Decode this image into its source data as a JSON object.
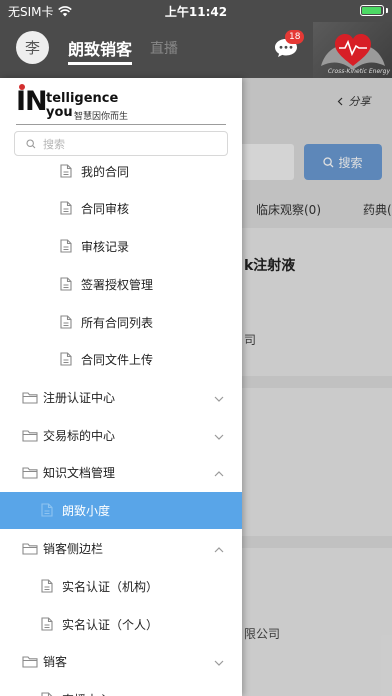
{
  "status_bar": {
    "carrier": "无SIM卡",
    "time": "上午11:42",
    "battery_level": 0.95
  },
  "header": {
    "avatar_char": "李",
    "tab_main": "朗致销客",
    "tab_live": "直播",
    "message_count": "18",
    "brand_caption": "Cross-Kinetic Energy"
  },
  "background": {
    "share_label": "分享",
    "search_button": "搜索",
    "tabs": [
      "临床观察(0)",
      "药典("
    ],
    "card_title": "k注射液",
    "card_line1": "司",
    "card_line2": "限公司"
  },
  "drawer": {
    "logo": {
      "letters": "IN",
      "word1": "telligence",
      "word2": "you",
      "tagline": "智慧因你而生"
    },
    "search_placeholder": "搜索",
    "items": [
      {
        "label": "我的合同"
      },
      {
        "label": "合同审核"
      },
      {
        "label": "审核记录"
      },
      {
        "label": "签署授权管理"
      },
      {
        "label": "所有合同列表"
      },
      {
        "label": "合同文件上传"
      },
      {
        "label": "注册认证中心"
      },
      {
        "label": "交易标的中心"
      },
      {
        "label": "知识文档管理"
      },
      {
        "label": "朗致小度"
      },
      {
        "label": "销客侧边栏"
      },
      {
        "label": "实名认证（机构）"
      },
      {
        "label": "实名认证（个人）"
      },
      {
        "label": "销客"
      },
      {
        "label": "直播中心"
      }
    ]
  },
  "colors": {
    "header_bg": "#4b4b4b",
    "accent": "#59a5e8",
    "badge": "#e53935",
    "search_button": "#6a9ad3"
  }
}
